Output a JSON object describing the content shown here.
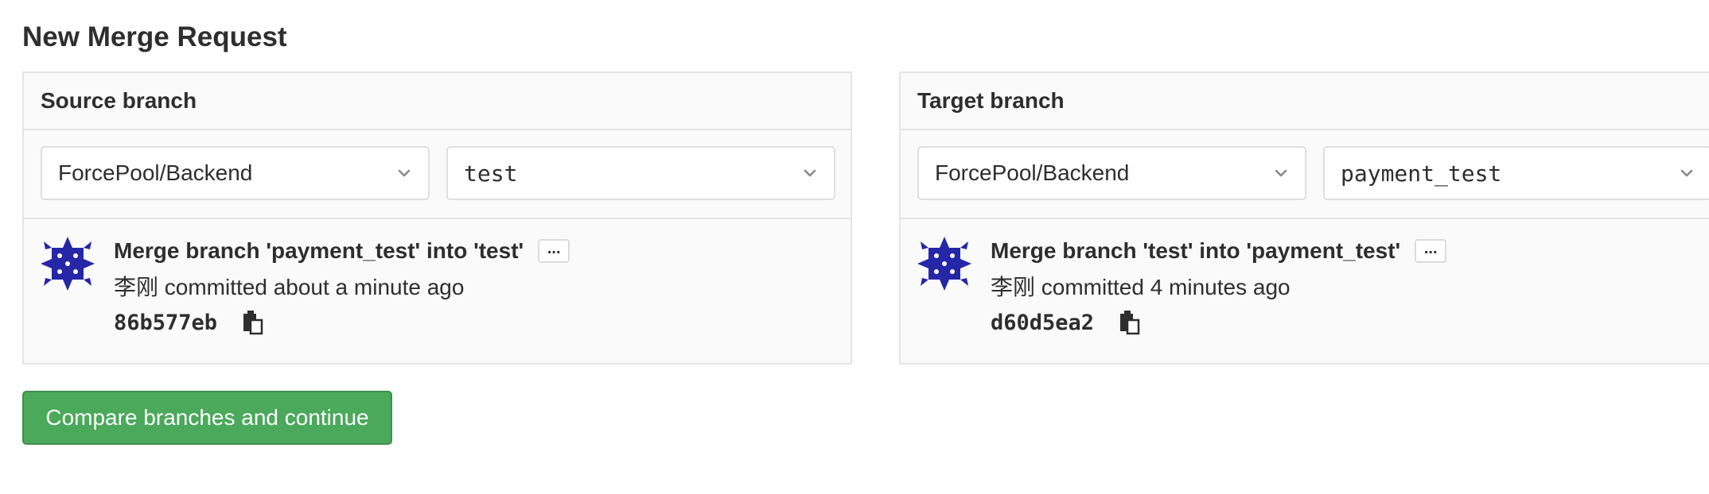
{
  "page": {
    "title": "New Merge Request"
  },
  "source": {
    "header": "Source branch",
    "project": "ForcePool/Backend",
    "branch": "test",
    "commit": {
      "title": "Merge branch 'payment_test' into 'test'",
      "ellipsis": "...",
      "meta": "李刚 committed about a minute ago",
      "sha": "86b577eb"
    }
  },
  "target": {
    "header": "Target branch",
    "project": "ForcePool/Backend",
    "branch": "payment_test",
    "commit": {
      "title": "Merge branch 'test' into 'payment_test'",
      "ellipsis": "...",
      "meta": "李刚 committed 4 minutes ago",
      "sha": "d60d5ea2"
    }
  },
  "actions": {
    "compare_label": "Compare branches and continue"
  },
  "icons": {
    "chevron": "chevron-down-icon",
    "copy": "copy-icon",
    "avatar": "identicon-avatar"
  },
  "colors": {
    "primary_button": "#4aa95a",
    "avatar": "#2626a8"
  }
}
